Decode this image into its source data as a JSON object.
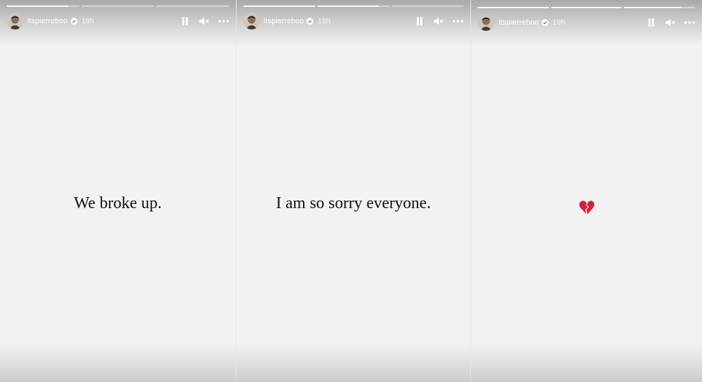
{
  "colors": {
    "background": "#f2f2f2",
    "text": "#111111",
    "heart": "#d0233a",
    "verified": "#3897f0"
  },
  "stories": [
    {
      "username": "itspierreboo",
      "time": "19h",
      "progress": [
        0.85,
        0,
        0
      ],
      "content_text": "We broke up."
    },
    {
      "username": "itspierreboo",
      "time": "19h",
      "progress": [
        1,
        0.85,
        0
      ],
      "content_text": "I am so sorry everyone."
    },
    {
      "username": "itspierreboo",
      "time": "19h",
      "progress": [
        1,
        1,
        0.8
      ],
      "content_icon": "broken-heart-icon"
    }
  ]
}
